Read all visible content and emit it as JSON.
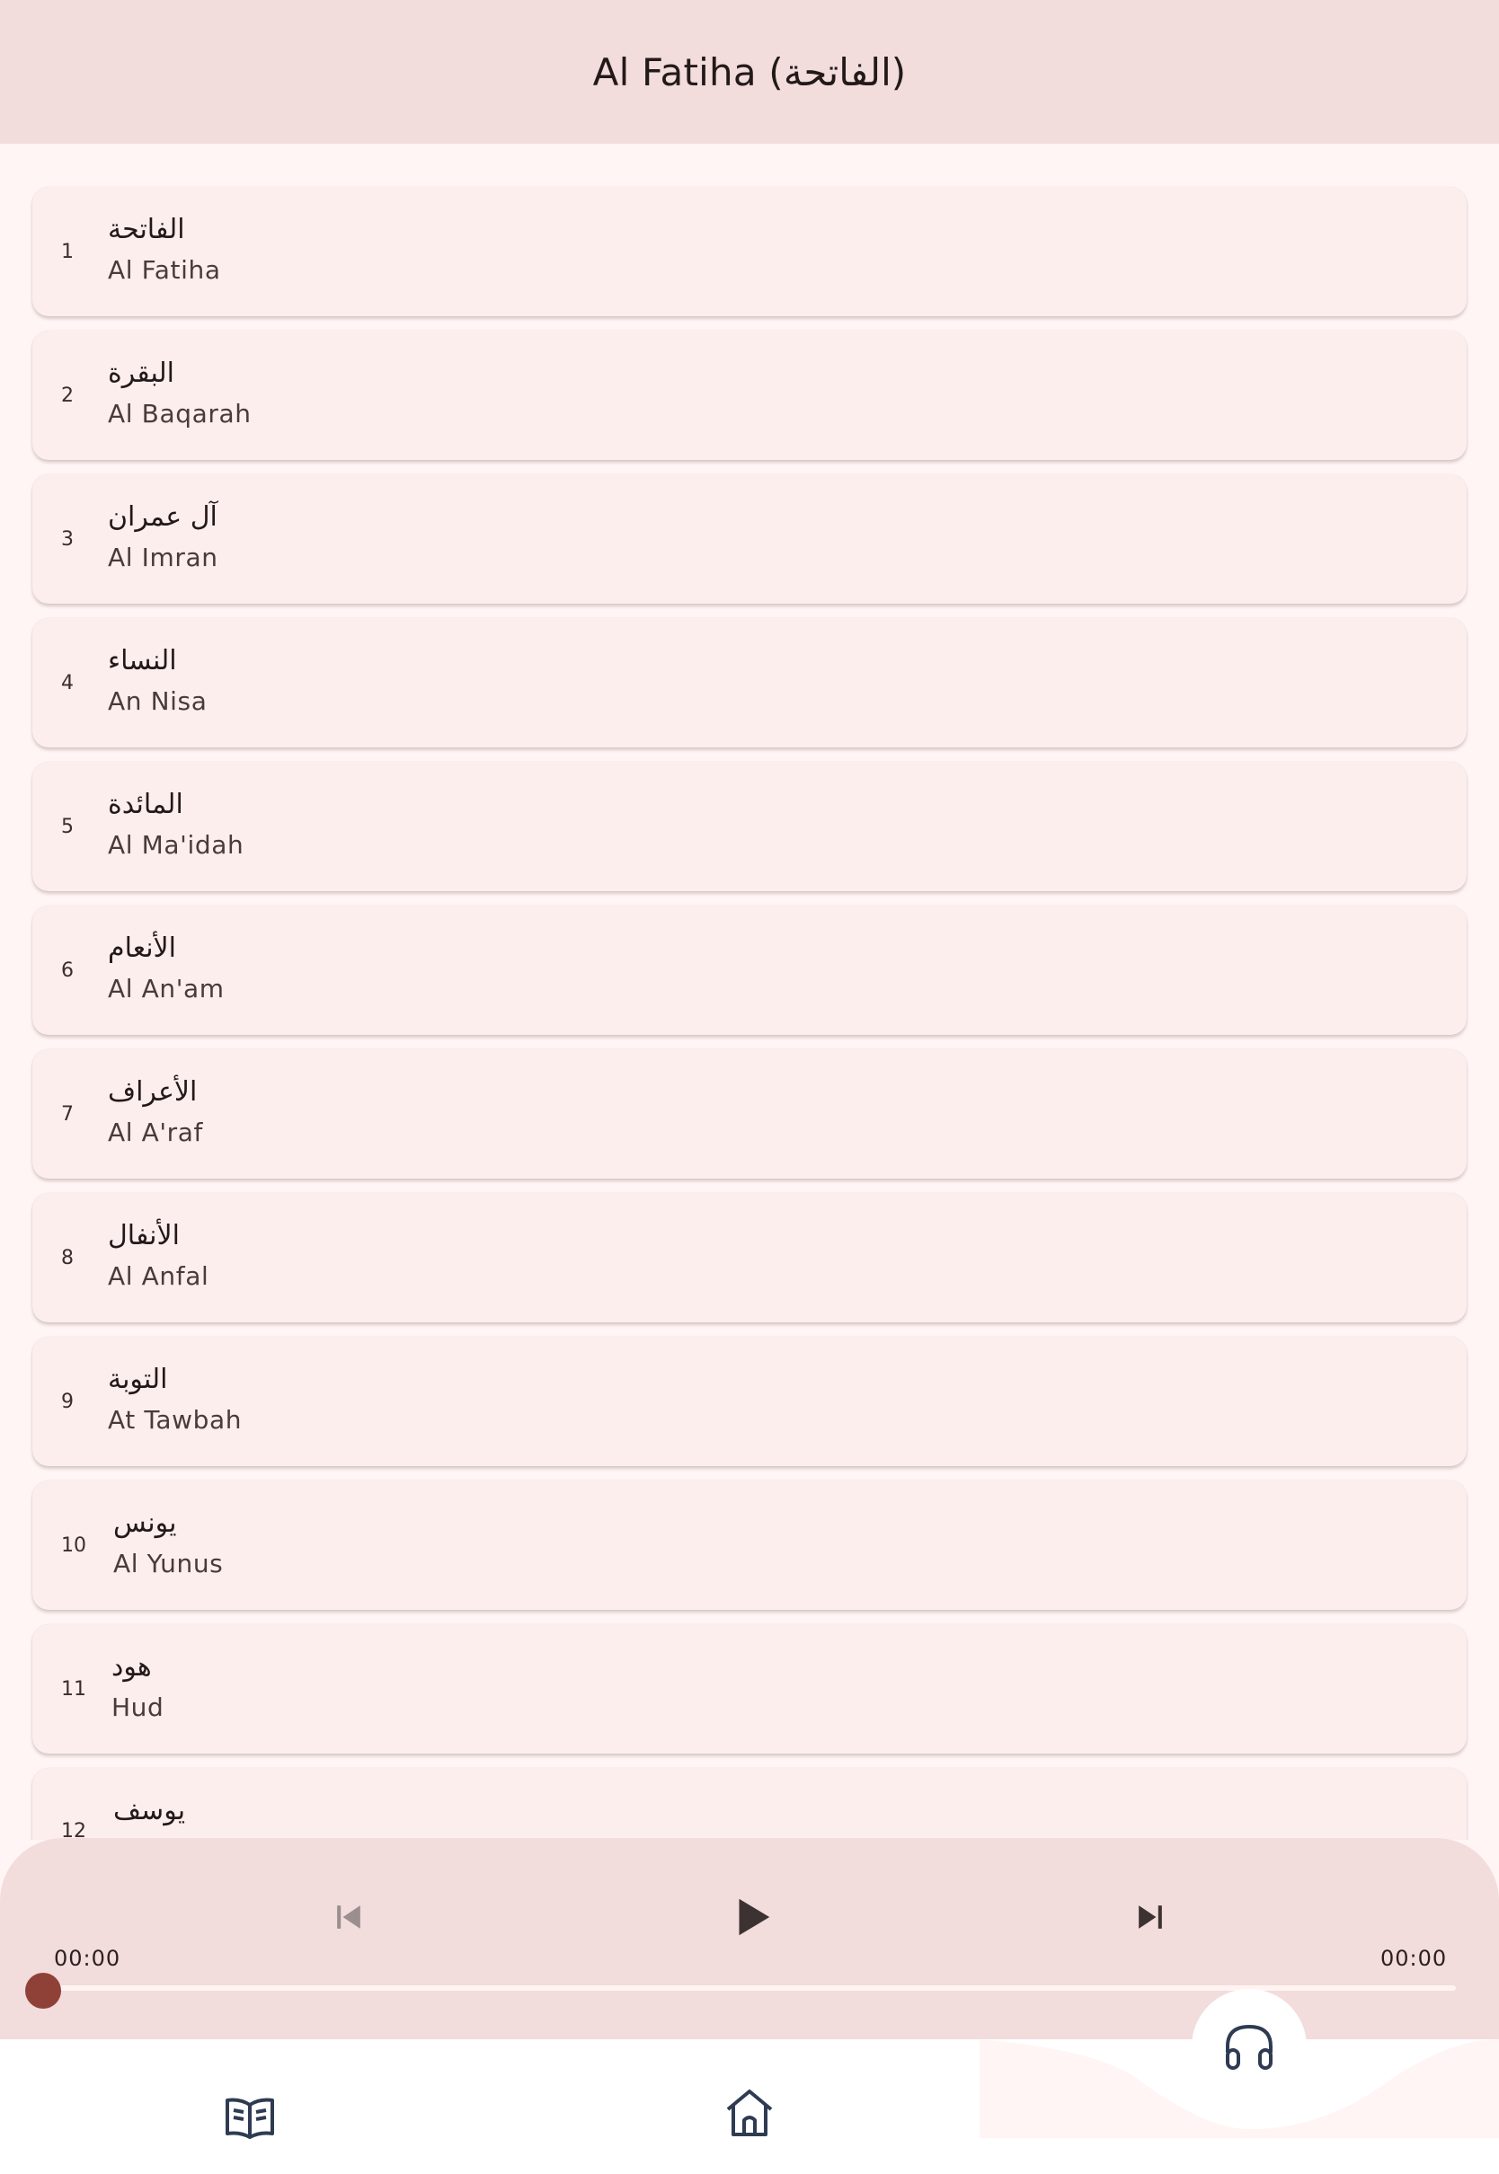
{
  "header": {
    "title": "Al Fatiha (الفاتحة)"
  },
  "surahs": [
    {
      "number": "1",
      "arabic": "الفاتحة",
      "name": "Al Fatiha"
    },
    {
      "number": "2",
      "arabic": "البقرة",
      "name": "Al Baqarah"
    },
    {
      "number": "3",
      "arabic": "آل عمران",
      "name": "Al Imran"
    },
    {
      "number": "4",
      "arabic": "النساء",
      "name": "An Nisa"
    },
    {
      "number": "5",
      "arabic": "المائدة",
      "name": "Al Ma'idah"
    },
    {
      "number": "6",
      "arabic": "الأنعام",
      "name": "Al An'am"
    },
    {
      "number": "7",
      "arabic": "الأعراف",
      "name": "Al A'raf"
    },
    {
      "number": "8",
      "arabic": "الأنفال",
      "name": "Al Anfal"
    },
    {
      "number": "9",
      "arabic": "التوبة",
      "name": "At Tawbah"
    },
    {
      "number": "10",
      "arabic": "يونس",
      "name": "Al Yunus"
    },
    {
      "number": "11",
      "arabic": "هود",
      "name": "Hud"
    },
    {
      "number": "12",
      "arabic": "يوسف",
      "name": ""
    }
  ],
  "player": {
    "current_time": "00:00",
    "total_time": "00:00",
    "progress": 0,
    "icons": {
      "previous": "skip-previous-icon",
      "play": "play-icon",
      "next": "skip-next-icon"
    }
  },
  "nav": {
    "items": [
      {
        "icon": "book-icon"
      },
      {
        "icon": "home-icon"
      },
      {
        "icon": "headphones-icon"
      }
    ]
  },
  "colors": {
    "header_bg": "#f2dcdc",
    "page_bg": "#fff5f4",
    "card_bg": "#fdeeee",
    "accent": "#8f4138",
    "icon_dark": "#3d3232"
  }
}
